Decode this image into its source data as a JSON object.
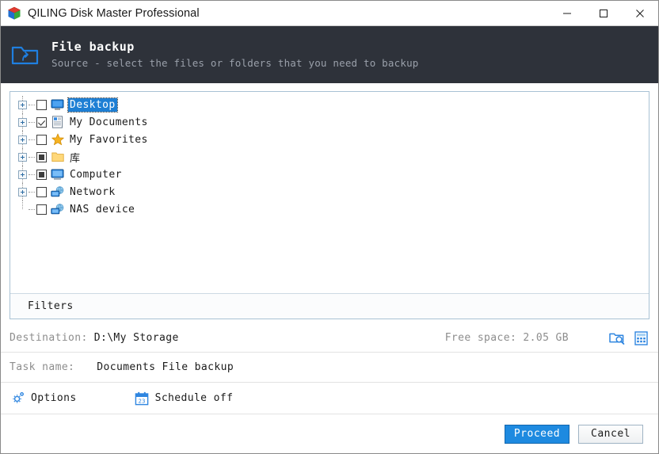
{
  "window": {
    "title": "QILING Disk Master Professional",
    "app_icon": "cube-icon",
    "controls": [
      {
        "name": "minimize",
        "glyph": "minimize-icon"
      },
      {
        "name": "maximize",
        "glyph": "maximize-icon"
      },
      {
        "name": "close",
        "glyph": "close-icon"
      }
    ]
  },
  "header": {
    "icon": "folder-backup-icon",
    "title": "File backup",
    "subtitle": "Source - select the files or folders that you need to backup"
  },
  "tree": {
    "nodes": [
      {
        "label": "Desktop",
        "icon": "desktop-icon",
        "checkbox": "unchecked",
        "expandable": true,
        "selected": true
      },
      {
        "label": "My Documents",
        "icon": "documents-icon",
        "checkbox": "checked",
        "expandable": true,
        "selected": false
      },
      {
        "label": "My Favorites",
        "icon": "star-icon",
        "checkbox": "unchecked",
        "expandable": true,
        "selected": false
      },
      {
        "label": "库",
        "icon": "folder-icon",
        "checkbox": "partial",
        "expandable": true,
        "selected": false
      },
      {
        "label": "Computer",
        "icon": "computer-icon",
        "checkbox": "partial",
        "expandable": true,
        "selected": false
      },
      {
        "label": "Network",
        "icon": "network-icon",
        "checkbox": "unchecked",
        "expandable": true,
        "selected": false
      },
      {
        "label": "NAS device",
        "icon": "nas-icon",
        "checkbox": "unchecked",
        "expandable": false,
        "selected": false
      }
    ],
    "filters_label": "Filters"
  },
  "destination": {
    "label": "Destination:",
    "value": "D:\\My Storage",
    "free_space": "Free space: 2.05 GB",
    "browse_icon": "folder-search-icon",
    "grid_icon": "disk-grid-icon"
  },
  "task": {
    "label": "Task name:",
    "value": "Documents File backup"
  },
  "options": {
    "options_label": "Options",
    "options_icon": "gear-icon",
    "schedule_label": "Schedule off",
    "schedule_icon": "calendar-icon",
    "calendar_day": "23"
  },
  "footer": {
    "proceed_label": "Proceed",
    "cancel_label": "Cancel"
  },
  "colors": {
    "header_bg": "#2e323a",
    "accent": "#1e8ae0",
    "selection": "#1e7fd4",
    "panel_border": "#a9c2d4"
  }
}
